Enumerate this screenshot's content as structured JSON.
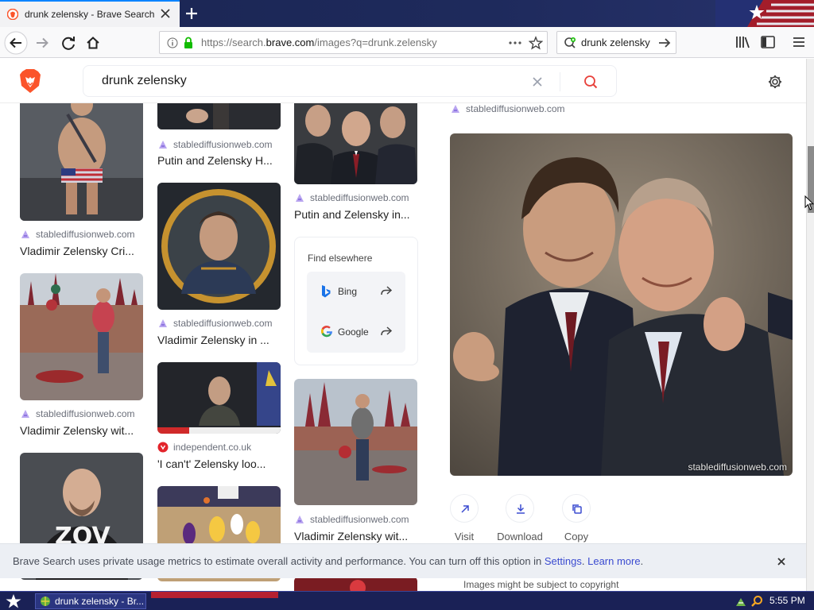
{
  "browser": {
    "tab_title": "drunk zelensky - Brave Search",
    "url_prefix": "https://search.",
    "url_domain": "brave.com",
    "url_suffix": "/images?q=drunk.zelensky",
    "search_field_value": "drunk zelensky"
  },
  "search": {
    "query": "drunk zelensky"
  },
  "results": [
    {
      "source": "stablediffusionweb.com",
      "caption": "Vladimir Zelensky Cri..."
    },
    {
      "source": "stablediffusionweb.com",
      "caption": "Vladimir Zelensky wit..."
    },
    {
      "source": "stablediffusionweb.com",
      "caption": "Putin and Zelensky H..."
    },
    {
      "source": "stablediffusionweb.com",
      "caption": "Vladimir Zelensky in ..."
    },
    {
      "source": "independent.co.uk",
      "caption": "'I can't' Zelensky loo..."
    },
    {
      "source": "stablediffusionweb.com",
      "caption": "Putin and Zelensky in..."
    },
    {
      "source": "stablediffusionweb.com",
      "caption": "Vladimir Zelensky wit..."
    }
  ],
  "thumbnail_texts": {
    "zov_shirt": "ZOV"
  },
  "find_elsewhere": {
    "title": "Find elsewhere",
    "engines": [
      {
        "name": "Bing"
      },
      {
        "name": "Google"
      }
    ]
  },
  "preview": {
    "source": "stablediffusionweb.com",
    "watermark": "stablediffusionweb.com",
    "actions": {
      "visit": "Visit",
      "download": "Download",
      "copy": "Copy"
    },
    "copyright_note": "Images might be subject to copyright"
  },
  "banner": {
    "message": "Brave Search uses private usage metrics to estimate overall activity and performance. You can turn off this option in ",
    "settings_link": "Settings",
    "sep": ". ",
    "learn_more": "Learn more",
    "end": "."
  },
  "taskbar": {
    "item_label": "drunk zelensky - Br...",
    "clock": "5:55 PM"
  },
  "colors": {
    "brave_orange": "#fb542b",
    "link_blue": "#3b4bd0",
    "search_red": "#e8413b"
  }
}
